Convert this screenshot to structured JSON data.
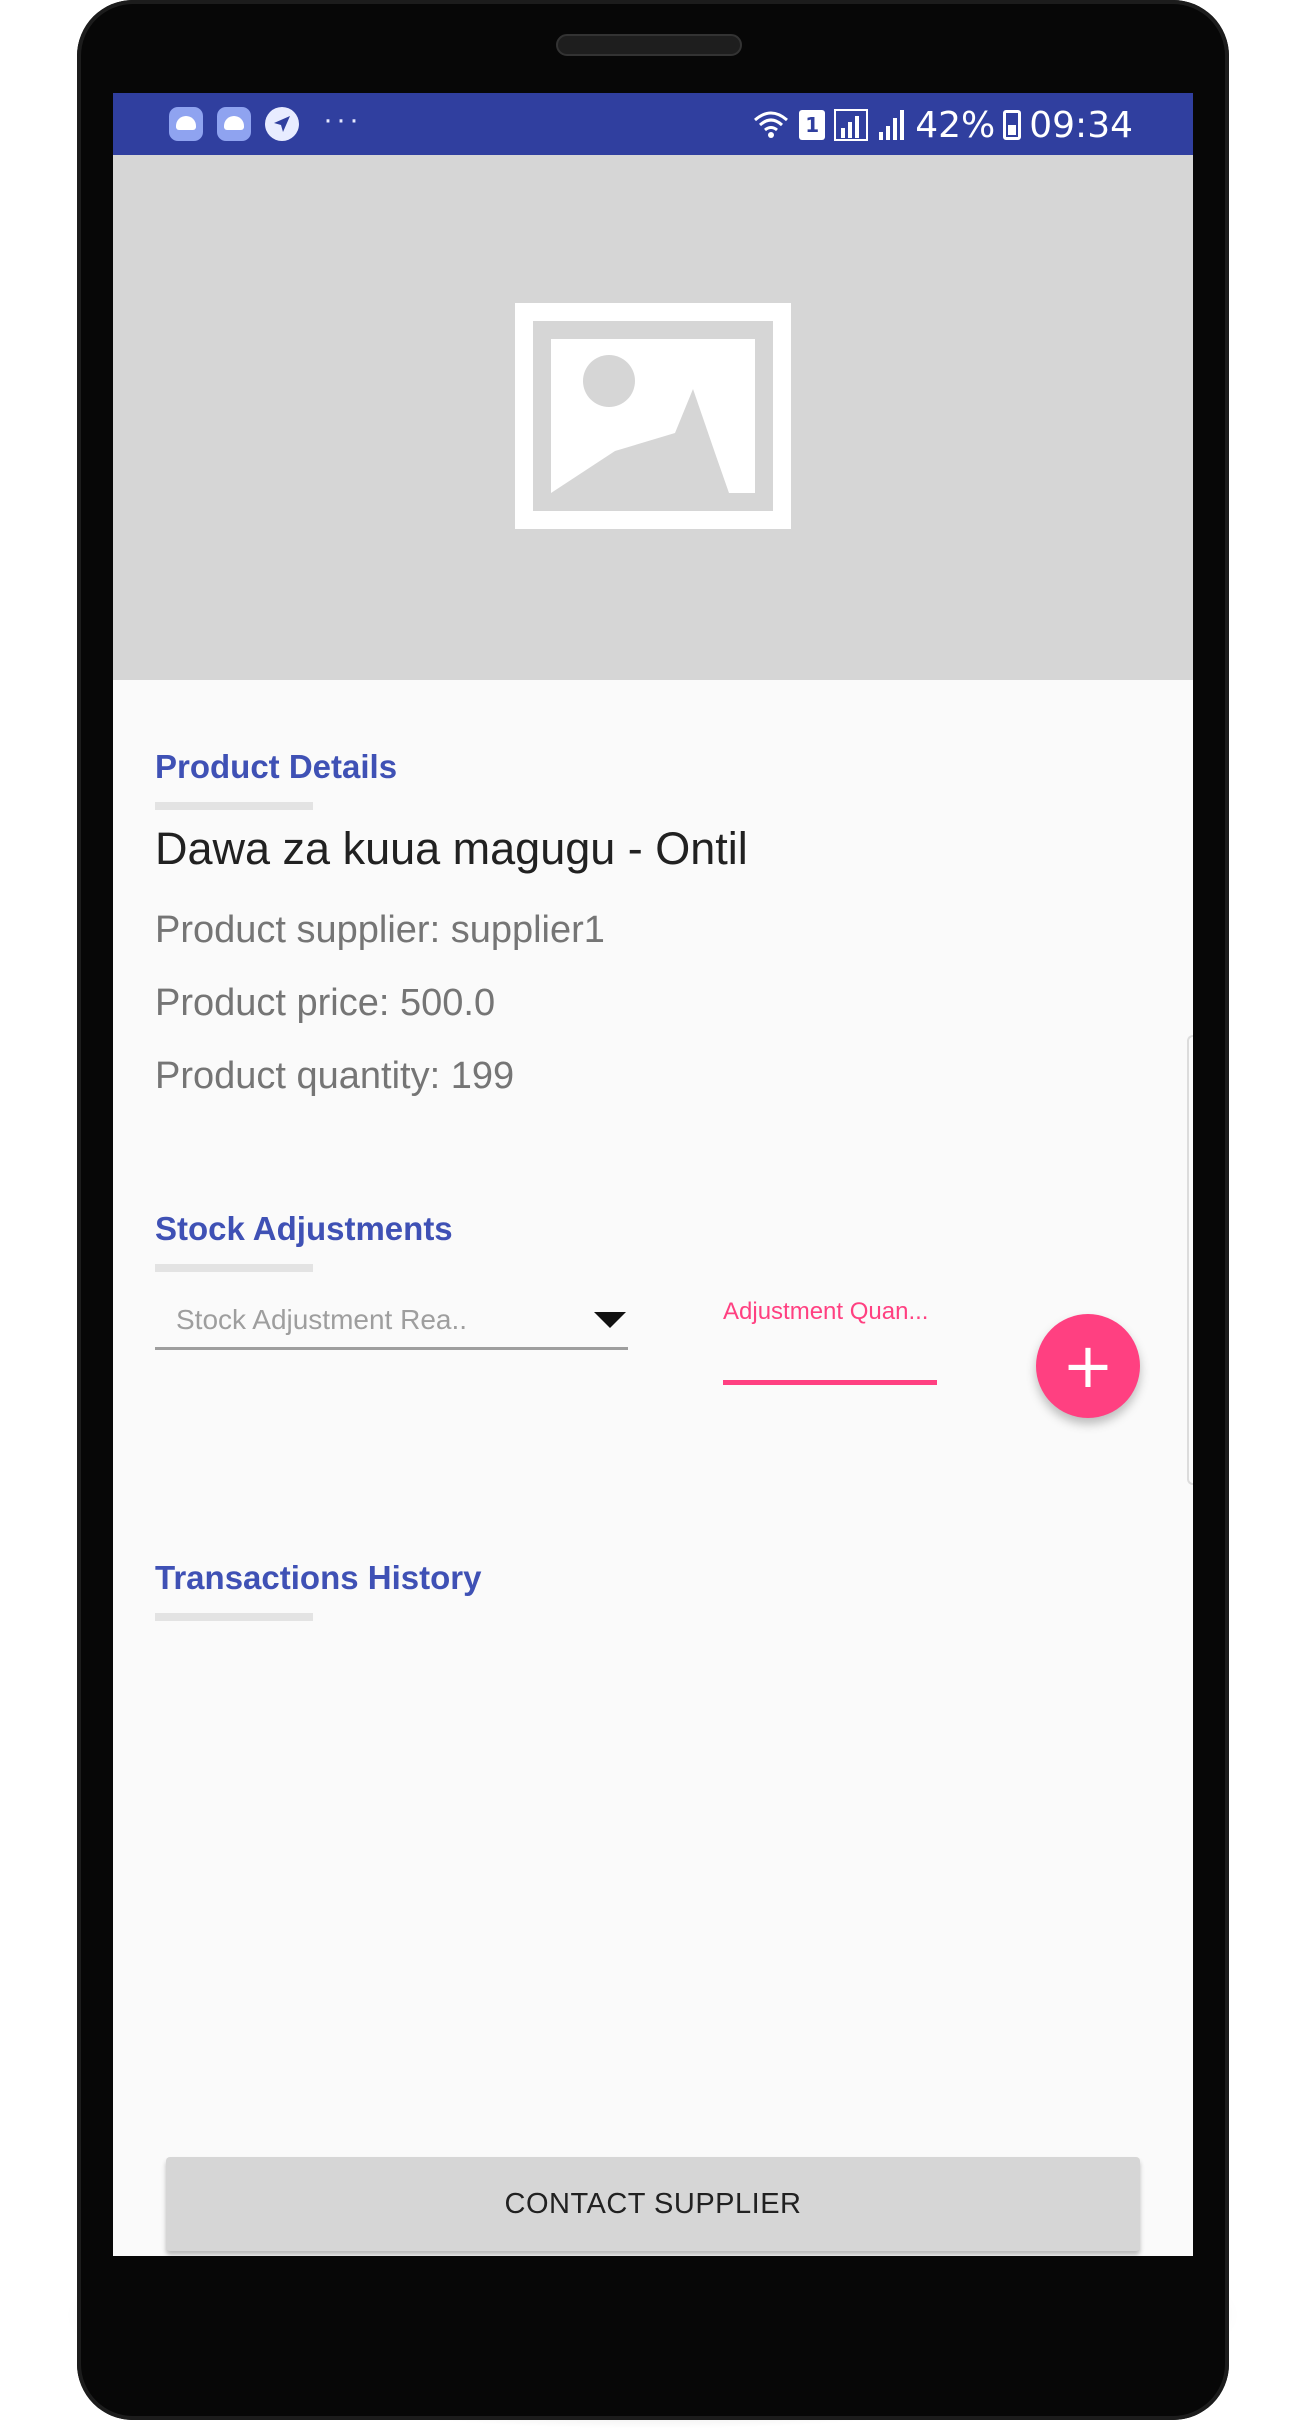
{
  "status_bar": {
    "battery_percent": "42%",
    "sim_slot": "1",
    "time": "09:34",
    "dots": "···",
    "left_icons": [
      "android-notification-icon",
      "android-notification-icon",
      "navigation-icon",
      "more-dots-icon"
    ],
    "right_icons": [
      "wifi-icon",
      "sim-icon",
      "signal-icon",
      "signal-icon",
      "battery-icon"
    ]
  },
  "hero": {
    "icon": "image-placeholder-icon"
  },
  "product_details": {
    "section_title": "Product Details",
    "name": "Dawa za kuua magugu - Ontil",
    "supplier": "Product supplier: supplier1",
    "price": "Product price: 500.0",
    "quantity": "Product quantity: 199"
  },
  "stock_adjustments": {
    "section_title": "Stock Adjustments",
    "reason_placeholder": "Stock Adjustment Rea..",
    "quantity_label": "Adjustment Quan...",
    "quantity_value": "",
    "add_button": "+"
  },
  "transactions": {
    "section_title": "Transactions History"
  },
  "contact_button": "CONTACT SUPPLIER",
  "colors": {
    "primary": "#3f51b5",
    "status_bar": "#303f9f",
    "accent": "#ff4081",
    "image_background": "#d6d6d6"
  }
}
